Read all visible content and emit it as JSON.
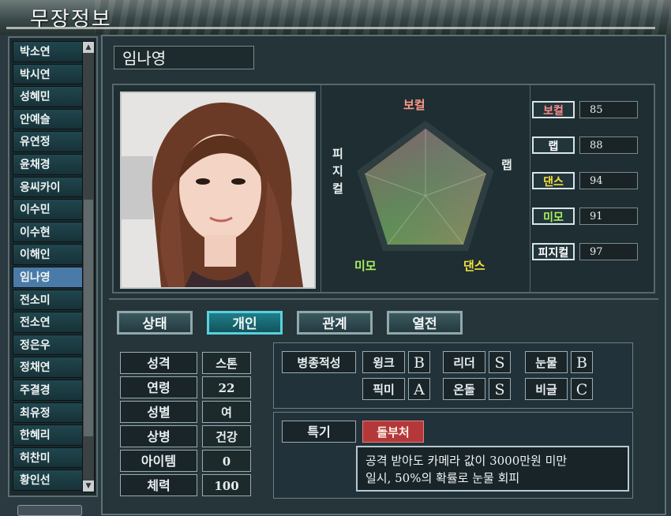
{
  "window": {
    "title": "무장정보"
  },
  "roster": {
    "items": [
      "박소연",
      "박시연",
      "성혜민",
      "안예슬",
      "유연정",
      "윤채경",
      "응씨카이",
      "이수민",
      "이수현",
      "이해인",
      "임나영",
      "전소미",
      "전소연",
      "정은우",
      "정채연",
      "주결경",
      "최유정",
      "한혜리",
      "허찬미",
      "황인선"
    ],
    "selected_index": 10
  },
  "profile": {
    "name": "임나영",
    "radar": {
      "labels": {
        "vocal": "보컬",
        "rap": "랩",
        "dance": "댄스",
        "looks": "미모",
        "physical": "피지컬"
      }
    },
    "stats": [
      {
        "label": "보컬",
        "value": "85",
        "label_color": "#ff8c8c"
      },
      {
        "label": "랩",
        "value": "88",
        "label_color": "#ffffff"
      },
      {
        "label": "댄스",
        "value": "94",
        "label_color": "#f4e040"
      },
      {
        "label": "미모",
        "value": "91",
        "label_color": "#a8f060"
      },
      {
        "label": "피지컬",
        "value": "97",
        "label_color": "#ffffff"
      }
    ]
  },
  "tabs": [
    "상태",
    "개인",
    "관계",
    "열전"
  ],
  "active_tab": "개인",
  "attributes": [
    {
      "label": "성격",
      "value": "스톤"
    },
    {
      "label": "연령",
      "value": "22"
    },
    {
      "label": "성별",
      "value": "여"
    },
    {
      "label": "상병",
      "value": "건강"
    },
    {
      "label": "아이템",
      "value": "0"
    },
    {
      "label": "체력",
      "value": "100"
    }
  ],
  "aptitude": {
    "title": "병종적성",
    "items": [
      {
        "name": "윙크",
        "grade": "B"
      },
      {
        "name": "리더",
        "grade": "S"
      },
      {
        "name": "눈물",
        "grade": "B"
      },
      {
        "name": "픽미",
        "grade": "A"
      },
      {
        "name": "온돌",
        "grade": "S"
      },
      {
        "name": "비글",
        "grade": "C"
      }
    ]
  },
  "special": {
    "label": "특기",
    "name": "돌부처",
    "description_line1": "공격 받아도 카메라 값이 3000만원 미만",
    "description_line2": "일시, 50%의 확률로 눈물 회피"
  },
  "colors": {
    "selected_item": "#4a7aa8",
    "active_tab": "#1e7f8a",
    "special_badge": "#b4383a"
  }
}
